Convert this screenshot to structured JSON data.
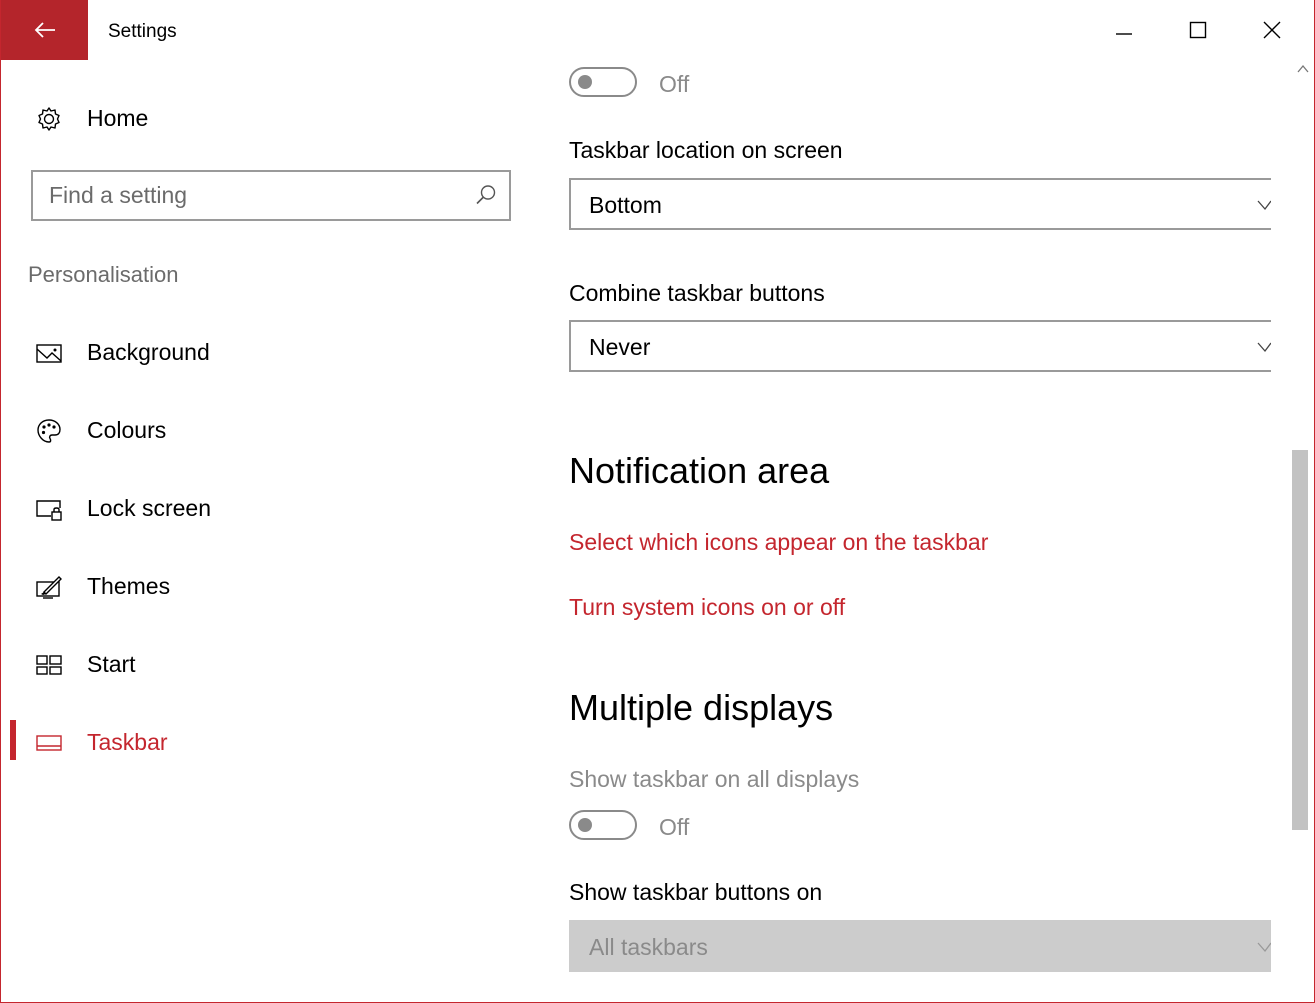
{
  "window": {
    "title": "Settings",
    "accent": "#c4262e",
    "back_icon": "arrow-left-icon",
    "controls": [
      "minimize-icon",
      "maximize-icon",
      "close-icon"
    ]
  },
  "sidebar": {
    "home": {
      "label": "Home",
      "icon": "gear-icon"
    },
    "search": {
      "placeholder": "Find a setting",
      "value": "",
      "icon": "search-icon"
    },
    "section_label": "Personalisation",
    "items": [
      {
        "label": "Background",
        "icon": "picture-icon",
        "active": false
      },
      {
        "label": "Colours",
        "icon": "palette-icon",
        "active": false
      },
      {
        "label": "Lock screen",
        "icon": "lock-screen-icon",
        "active": false
      },
      {
        "label": "Themes",
        "icon": "brush-icon",
        "active": false
      },
      {
        "label": "Start",
        "icon": "start-tiles-icon",
        "active": false
      },
      {
        "label": "Taskbar",
        "icon": "taskbar-icon",
        "active": true
      }
    ]
  },
  "content": {
    "top_toggle": {
      "state": "Off",
      "on": false
    },
    "taskbar_location": {
      "label": "Taskbar location on screen",
      "value": "Bottom"
    },
    "combine_buttons": {
      "label": "Combine taskbar buttons",
      "value": "Never"
    },
    "notification_area": {
      "heading": "Notification area",
      "links": [
        "Select which icons appear on the taskbar",
        "Turn system icons on or off"
      ]
    },
    "multiple_displays": {
      "heading": "Multiple displays",
      "show_all_label": "Show taskbar on all displays",
      "show_all_toggle": {
        "state": "Off",
        "on": false
      },
      "buttons_on_label": "Show taskbar buttons on",
      "buttons_on_value": "All taskbars",
      "buttons_on_disabled": true
    }
  },
  "scrollbar": {
    "position_fraction": 0.42
  }
}
